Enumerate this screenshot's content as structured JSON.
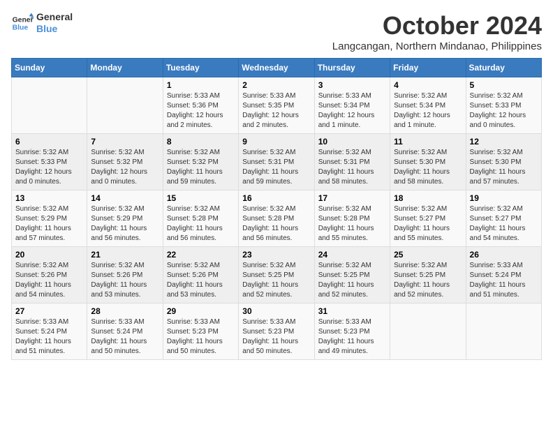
{
  "logo": {
    "line1": "General",
    "line2": "Blue"
  },
  "title": "October 2024",
  "location": "Langcangan, Northern Mindanao, Philippines",
  "days_header": [
    "Sunday",
    "Monday",
    "Tuesday",
    "Wednesday",
    "Thursday",
    "Friday",
    "Saturday"
  ],
  "weeks": [
    [
      {
        "day": "",
        "detail": ""
      },
      {
        "day": "",
        "detail": ""
      },
      {
        "day": "1",
        "detail": "Sunrise: 5:33 AM\nSunset: 5:36 PM\nDaylight: 12 hours\nand 2 minutes."
      },
      {
        "day": "2",
        "detail": "Sunrise: 5:33 AM\nSunset: 5:35 PM\nDaylight: 12 hours\nand 2 minutes."
      },
      {
        "day": "3",
        "detail": "Sunrise: 5:33 AM\nSunset: 5:34 PM\nDaylight: 12 hours\nand 1 minute."
      },
      {
        "day": "4",
        "detail": "Sunrise: 5:32 AM\nSunset: 5:34 PM\nDaylight: 12 hours\nand 1 minute."
      },
      {
        "day": "5",
        "detail": "Sunrise: 5:32 AM\nSunset: 5:33 PM\nDaylight: 12 hours\nand 0 minutes."
      }
    ],
    [
      {
        "day": "6",
        "detail": "Sunrise: 5:32 AM\nSunset: 5:33 PM\nDaylight: 12 hours\nand 0 minutes."
      },
      {
        "day": "7",
        "detail": "Sunrise: 5:32 AM\nSunset: 5:32 PM\nDaylight: 12 hours\nand 0 minutes."
      },
      {
        "day": "8",
        "detail": "Sunrise: 5:32 AM\nSunset: 5:32 PM\nDaylight: 11 hours\nand 59 minutes."
      },
      {
        "day": "9",
        "detail": "Sunrise: 5:32 AM\nSunset: 5:31 PM\nDaylight: 11 hours\nand 59 minutes."
      },
      {
        "day": "10",
        "detail": "Sunrise: 5:32 AM\nSunset: 5:31 PM\nDaylight: 11 hours\nand 58 minutes."
      },
      {
        "day": "11",
        "detail": "Sunrise: 5:32 AM\nSunset: 5:30 PM\nDaylight: 11 hours\nand 58 minutes."
      },
      {
        "day": "12",
        "detail": "Sunrise: 5:32 AM\nSunset: 5:30 PM\nDaylight: 11 hours\nand 57 minutes."
      }
    ],
    [
      {
        "day": "13",
        "detail": "Sunrise: 5:32 AM\nSunset: 5:29 PM\nDaylight: 11 hours\nand 57 minutes."
      },
      {
        "day": "14",
        "detail": "Sunrise: 5:32 AM\nSunset: 5:29 PM\nDaylight: 11 hours\nand 56 minutes."
      },
      {
        "day": "15",
        "detail": "Sunrise: 5:32 AM\nSunset: 5:28 PM\nDaylight: 11 hours\nand 56 minutes."
      },
      {
        "day": "16",
        "detail": "Sunrise: 5:32 AM\nSunset: 5:28 PM\nDaylight: 11 hours\nand 56 minutes."
      },
      {
        "day": "17",
        "detail": "Sunrise: 5:32 AM\nSunset: 5:28 PM\nDaylight: 11 hours\nand 55 minutes."
      },
      {
        "day": "18",
        "detail": "Sunrise: 5:32 AM\nSunset: 5:27 PM\nDaylight: 11 hours\nand 55 minutes."
      },
      {
        "day": "19",
        "detail": "Sunrise: 5:32 AM\nSunset: 5:27 PM\nDaylight: 11 hours\nand 54 minutes."
      }
    ],
    [
      {
        "day": "20",
        "detail": "Sunrise: 5:32 AM\nSunset: 5:26 PM\nDaylight: 11 hours\nand 54 minutes."
      },
      {
        "day": "21",
        "detail": "Sunrise: 5:32 AM\nSunset: 5:26 PM\nDaylight: 11 hours\nand 53 minutes."
      },
      {
        "day": "22",
        "detail": "Sunrise: 5:32 AM\nSunset: 5:26 PM\nDaylight: 11 hours\nand 53 minutes."
      },
      {
        "day": "23",
        "detail": "Sunrise: 5:32 AM\nSunset: 5:25 PM\nDaylight: 11 hours\nand 52 minutes."
      },
      {
        "day": "24",
        "detail": "Sunrise: 5:32 AM\nSunset: 5:25 PM\nDaylight: 11 hours\nand 52 minutes."
      },
      {
        "day": "25",
        "detail": "Sunrise: 5:32 AM\nSunset: 5:25 PM\nDaylight: 11 hours\nand 52 minutes."
      },
      {
        "day": "26",
        "detail": "Sunrise: 5:33 AM\nSunset: 5:24 PM\nDaylight: 11 hours\nand 51 minutes."
      }
    ],
    [
      {
        "day": "27",
        "detail": "Sunrise: 5:33 AM\nSunset: 5:24 PM\nDaylight: 11 hours\nand 51 minutes."
      },
      {
        "day": "28",
        "detail": "Sunrise: 5:33 AM\nSunset: 5:24 PM\nDaylight: 11 hours\nand 50 minutes."
      },
      {
        "day": "29",
        "detail": "Sunrise: 5:33 AM\nSunset: 5:23 PM\nDaylight: 11 hours\nand 50 minutes."
      },
      {
        "day": "30",
        "detail": "Sunrise: 5:33 AM\nSunset: 5:23 PM\nDaylight: 11 hours\nand 50 minutes."
      },
      {
        "day": "31",
        "detail": "Sunrise: 5:33 AM\nSunset: 5:23 PM\nDaylight: 11 hours\nand 49 minutes."
      },
      {
        "day": "",
        "detail": ""
      },
      {
        "day": "",
        "detail": ""
      }
    ]
  ]
}
